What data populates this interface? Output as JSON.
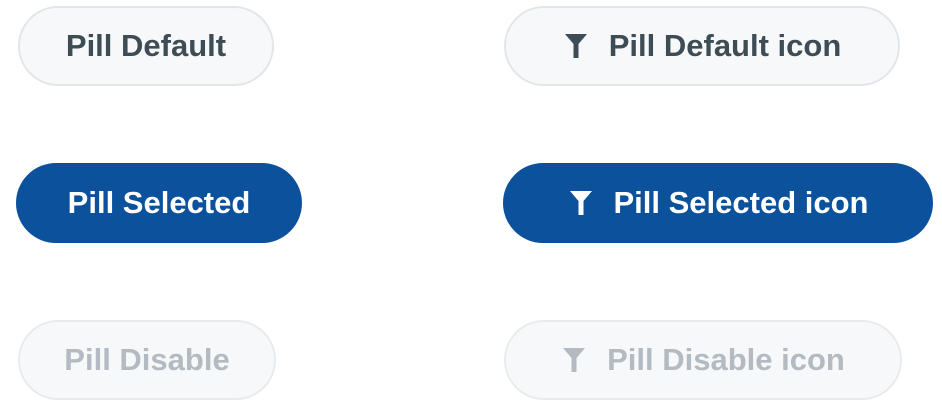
{
  "pills": {
    "default": {
      "label": "Pill Default",
      "state": "default"
    },
    "default_icon": {
      "label": "Pill Default icon",
      "state": "default",
      "icon": "filter-icon"
    },
    "selected": {
      "label": "Pill Selected",
      "state": "selected"
    },
    "selected_icon": {
      "label": "Pill Selected icon",
      "state": "selected",
      "icon": "filter-icon"
    },
    "disable": {
      "label": "Pill Disable",
      "state": "disabled"
    },
    "disable_icon": {
      "label": "Pill Disable icon",
      "state": "disabled",
      "icon": "filter-icon"
    }
  },
  "colors": {
    "selected_background": "#0b519c",
    "default_background": "#f7f8f9",
    "default_border": "#e3e6e9",
    "default_text": "#3e4c56",
    "disabled_text": "#b3bac1",
    "selected_text": "#ffffff"
  }
}
